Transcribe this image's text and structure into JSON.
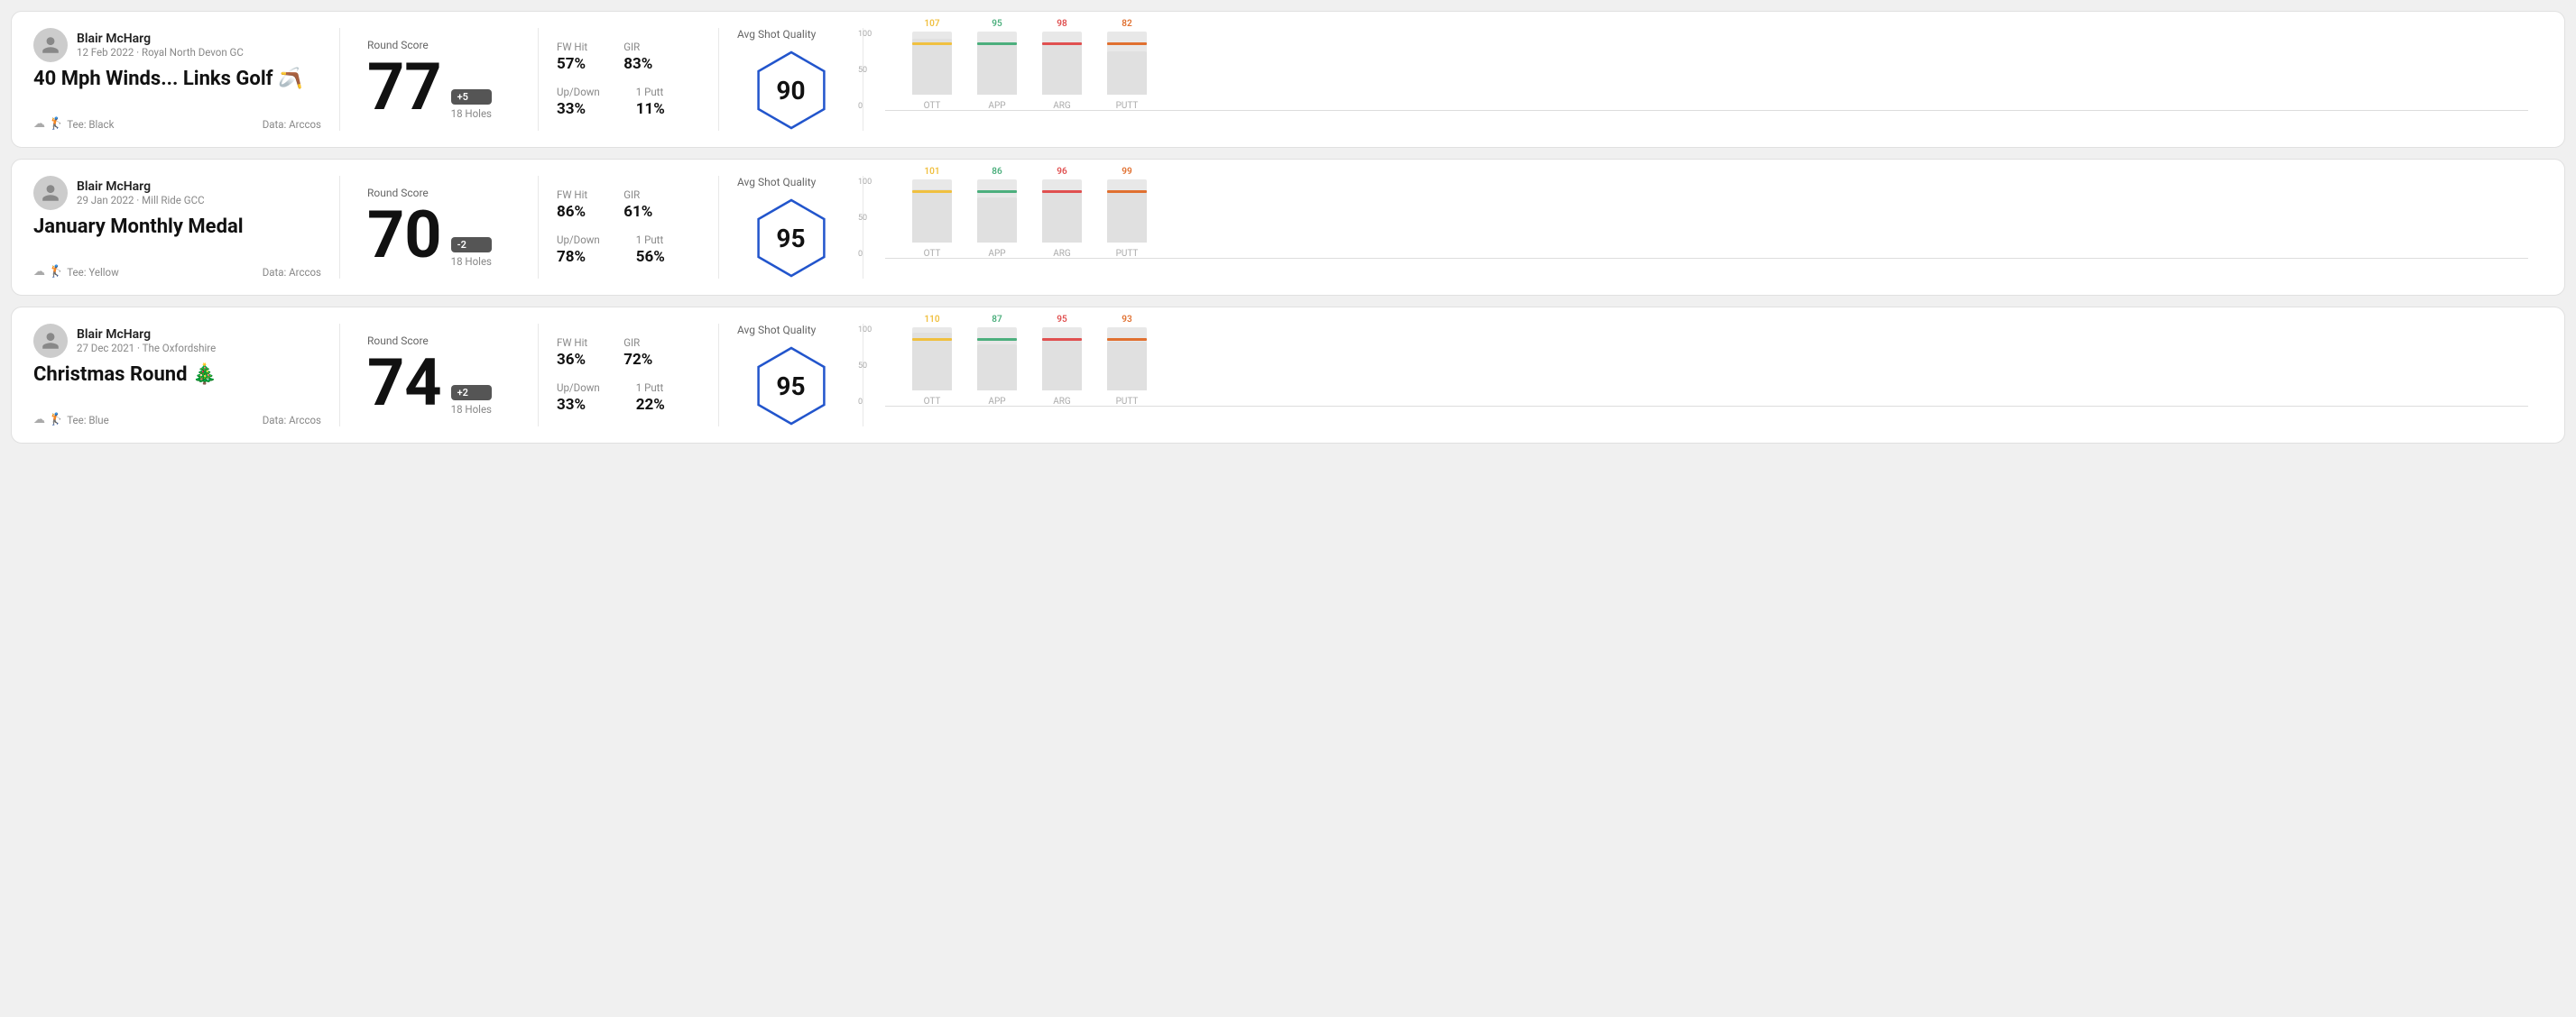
{
  "rounds": [
    {
      "id": "round1",
      "user_name": "Blair McHarg",
      "date_course": "12 Feb 2022 · Royal North Devon GC",
      "round_title": "40 Mph Winds... Links Golf",
      "title_emoji": "🪃",
      "tee": "Black",
      "data_source": "Data: Arccos",
      "round_score_label": "Round Score",
      "score": "77",
      "score_badge": "+5",
      "holes": "18 Holes",
      "fw_hit_label": "FW Hit",
      "fw_hit_value": "57%",
      "gir_label": "GIR",
      "gir_value": "83%",
      "updown_label": "Up/Down",
      "updown_value": "33%",
      "oneputt_label": "1 Putt",
      "oneputt_value": "11%",
      "quality_label": "Avg Shot Quality",
      "quality_score": "90",
      "bars": [
        {
          "label": "OTT",
          "value": 107,
          "color": "#f0c040"
        },
        {
          "label": "APP",
          "value": 95,
          "color": "#4caf7d"
        },
        {
          "label": "ARG",
          "value": 98,
          "color": "#e05050"
        },
        {
          "label": "PUTT",
          "value": 82,
          "color": "#e07030"
        }
      ]
    },
    {
      "id": "round2",
      "user_name": "Blair McHarg",
      "date_course": "29 Jan 2022 · Mill Ride GCC",
      "round_title": "January Monthly Medal",
      "title_emoji": "",
      "tee": "Yellow",
      "data_source": "Data: Arccos",
      "round_score_label": "Round Score",
      "score": "70",
      "score_badge": "-2",
      "holes": "18 Holes",
      "fw_hit_label": "FW Hit",
      "fw_hit_value": "86%",
      "gir_label": "GIR",
      "gir_value": "61%",
      "updown_label": "Up/Down",
      "updown_value": "78%",
      "oneputt_label": "1 Putt",
      "oneputt_value": "56%",
      "quality_label": "Avg Shot Quality",
      "quality_score": "95",
      "bars": [
        {
          "label": "OTT",
          "value": 101,
          "color": "#f0c040"
        },
        {
          "label": "APP",
          "value": 86,
          "color": "#4caf7d"
        },
        {
          "label": "ARG",
          "value": 96,
          "color": "#e05050"
        },
        {
          "label": "PUTT",
          "value": 99,
          "color": "#e07030"
        }
      ]
    },
    {
      "id": "round3",
      "user_name": "Blair McHarg",
      "date_course": "27 Dec 2021 · The Oxfordshire",
      "round_title": "Christmas Round",
      "title_emoji": "🎄",
      "tee": "Blue",
      "data_source": "Data: Arccos",
      "round_score_label": "Round Score",
      "score": "74",
      "score_badge": "+2",
      "holes": "18 Holes",
      "fw_hit_label": "FW Hit",
      "fw_hit_value": "36%",
      "gir_label": "GIR",
      "gir_value": "72%",
      "updown_label": "Up/Down",
      "updown_value": "33%",
      "oneputt_label": "1 Putt",
      "oneputt_value": "22%",
      "quality_label": "Avg Shot Quality",
      "quality_score": "95",
      "bars": [
        {
          "label": "OTT",
          "value": 110,
          "color": "#f0c040"
        },
        {
          "label": "APP",
          "value": 87,
          "color": "#4caf7d"
        },
        {
          "label": "ARG",
          "value": 95,
          "color": "#e05050"
        },
        {
          "label": "PUTT",
          "value": 93,
          "color": "#e07030"
        }
      ]
    }
  ],
  "chart": {
    "y_labels": [
      "100",
      "50",
      "0"
    ]
  }
}
